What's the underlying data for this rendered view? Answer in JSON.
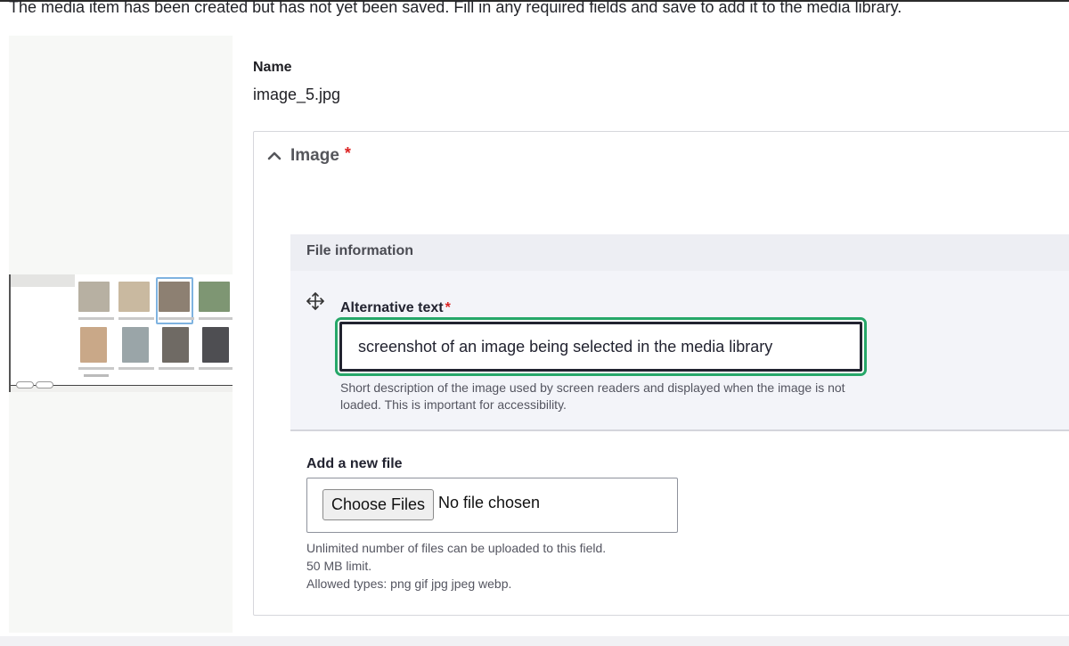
{
  "status_message": "The media item has been created but has not yet been saved. Fill in any required fields and save to add it to the media library.",
  "media_name": {
    "label": "Name",
    "value": "image_5.jpg"
  },
  "image_field": {
    "title": "Image",
    "required_mark": "*",
    "expanded": true,
    "file_information": {
      "title": "File information",
      "alt_text": {
        "label": "Alternative text",
        "required_mark": "*",
        "value": "screenshot of an image being selected in the media library",
        "help": "Short description of the image used by screen readers and displayed when the image is not loaded. This is important for accessibility."
      }
    },
    "add_new_file": {
      "label": "Add a new file",
      "button_label": "Choose Files",
      "status": "No file chosen",
      "help_lines": [
        "Unlimited number of files can be uploaded to this field.",
        "50 MB limit.",
        "Allowed types: png gif jpg jpeg webp."
      ]
    }
  },
  "colors": {
    "focus_ring": "#26a769",
    "required": "#dc2323",
    "panel_bg": "#f3f4f9"
  },
  "icons": {
    "collapse": "chevron-up-icon",
    "drag": "move-icon"
  }
}
